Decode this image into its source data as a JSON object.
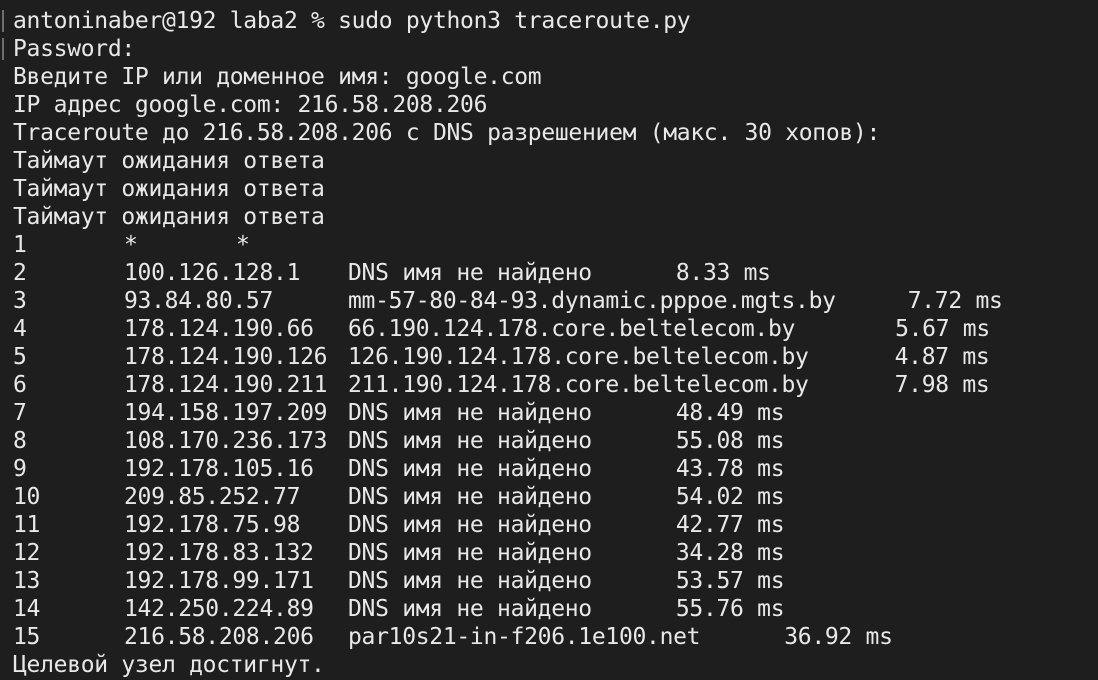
{
  "terminal": {
    "prompt_line": "antoninaber@192 laba2 % sudo python3 traceroute.py",
    "password_line": "Password:",
    "input_line": "Введите IP или доменное имя: google.com",
    "ip_line": "IP адрес google.com: 216.58.208.206",
    "header_line": "Traceroute до 216.58.208.206 с DNS разрешением (макс. 30 хопов):",
    "timeout_lines": [
      "Таймаут ожидания ответа",
      "Таймаут ожидания ответа",
      "Таймаут ожидания ответа"
    ],
    "hop1": {
      "hop": "1",
      "a": "*",
      "b": "*"
    },
    "hops": [
      {
        "hop": "2",
        "ip": "100.126.128.1",
        "name": "DNS имя не найдено",
        "time": "8.33 ms"
      },
      {
        "hop": "3",
        "ip": "93.84.80.57",
        "name": "mm-57-80-84-93.dynamic.pppoe.mgts.by",
        "time": "7.72 ms"
      },
      {
        "hop": "4",
        "ip": "178.124.190.66",
        "name": "66.190.124.178.core.beltelecom.by",
        "time": "5.67 ms"
      },
      {
        "hop": "5",
        "ip": "178.124.190.126",
        "name": "126.190.124.178.core.beltelecom.by",
        "time": "4.87 ms"
      },
      {
        "hop": "6",
        "ip": "178.124.190.211",
        "name": "211.190.124.178.core.beltelecom.by",
        "time": "7.98 ms"
      },
      {
        "hop": "7",
        "ip": "194.158.197.209",
        "name": "DNS имя не найдено",
        "time": "48.49 ms"
      },
      {
        "hop": "8",
        "ip": "108.170.236.173",
        "name": "DNS имя не найдено",
        "time": "55.08 ms"
      },
      {
        "hop": "9",
        "ip": "192.178.105.16",
        "name": "DNS имя не найдено",
        "time": "43.78 ms"
      },
      {
        "hop": "10",
        "ip": "209.85.252.77",
        "name": "DNS имя не найдено",
        "time": "54.02 ms"
      },
      {
        "hop": "11",
        "ip": "192.178.75.98",
        "name": "DNS имя не найдено",
        "time": "42.77 ms"
      },
      {
        "hop": "12",
        "ip": "192.178.83.132",
        "name": "DNS имя не найдено",
        "time": "34.28 ms"
      },
      {
        "hop": "13",
        "ip": "192.178.99.171",
        "name": "DNS имя не найдено",
        "time": "53.57 ms"
      },
      {
        "hop": "14",
        "ip": "142.250.224.89",
        "name": "DNS имя не найдено",
        "time": "55.76 ms"
      },
      {
        "hop": "15",
        "ip": "216.58.208.206",
        "name": "par10s21-in-f206.1e100.net",
        "time": "36.92 ms"
      }
    ],
    "final_line": "Целевой узел достигнут."
  }
}
